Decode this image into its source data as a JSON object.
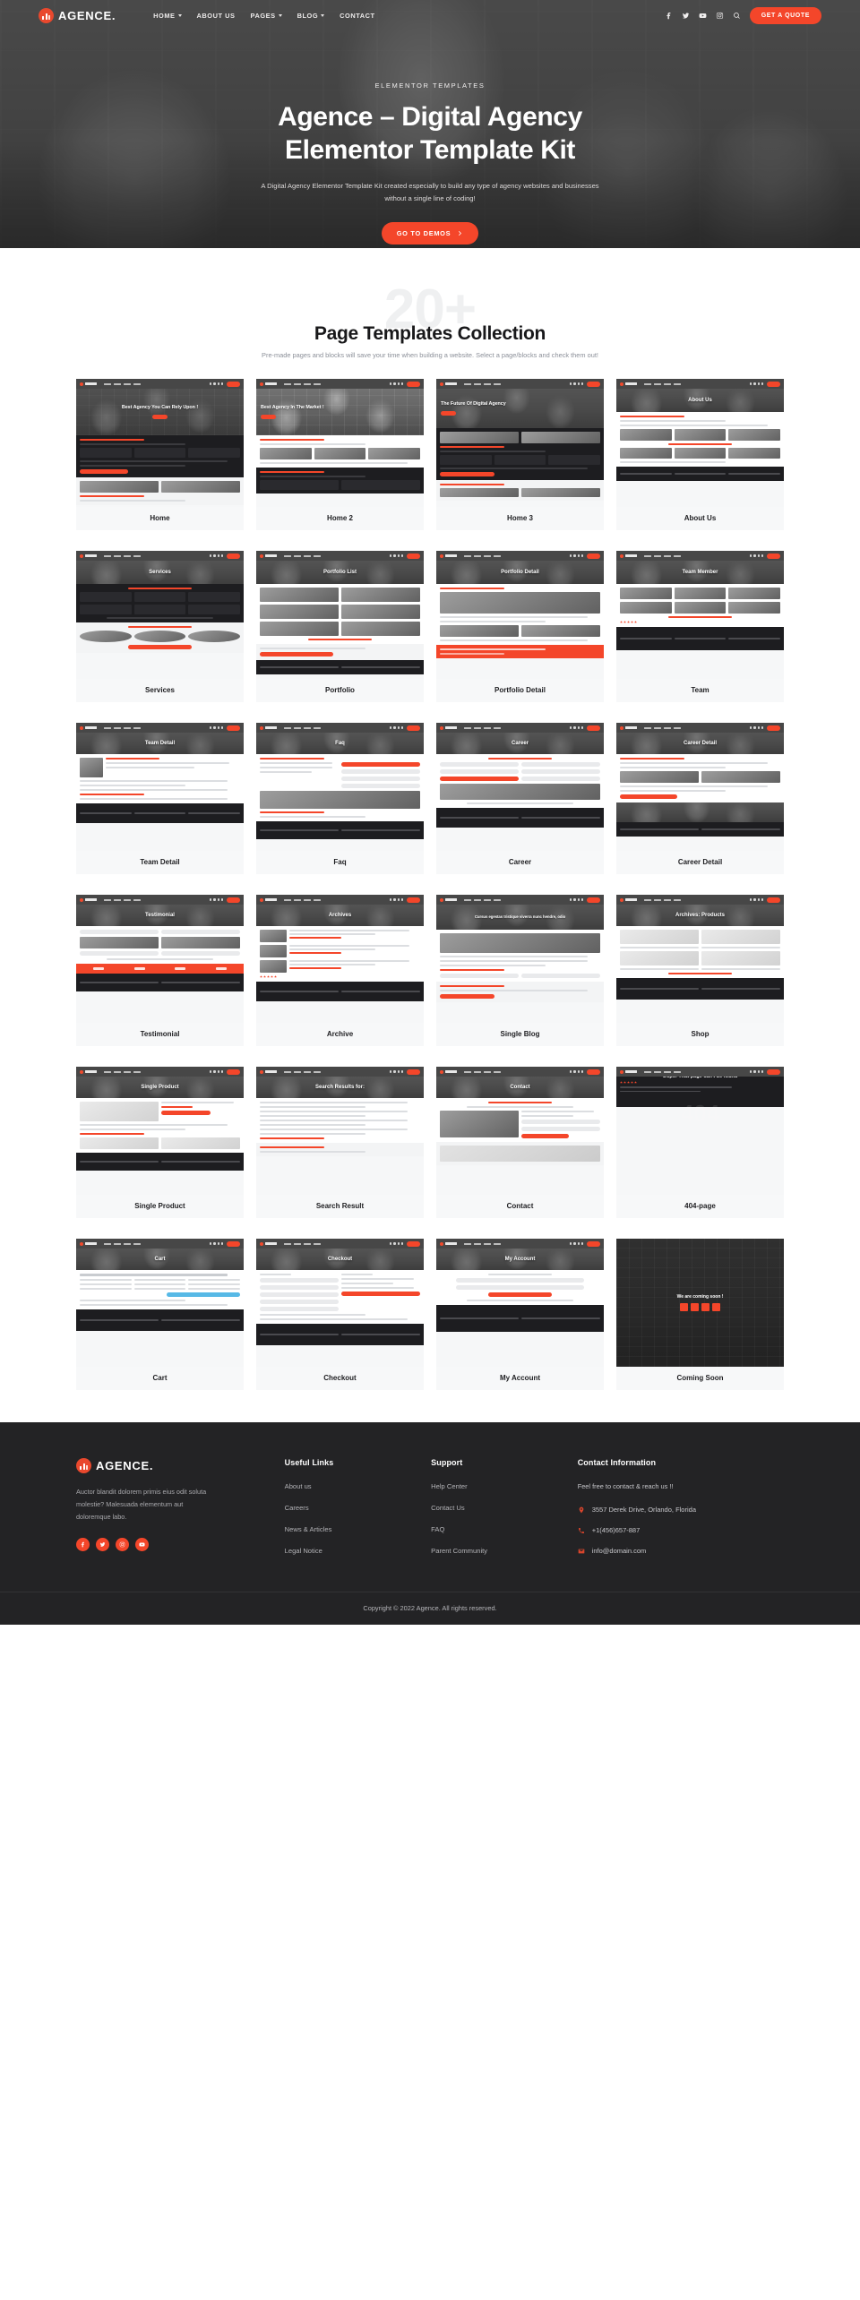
{
  "colors": {
    "accent": "#f4462a",
    "dark": "#232325",
    "light": "#f7f8f9"
  },
  "header": {
    "brand": "AGENCE.",
    "menu": [
      {
        "label": "HOME",
        "has_dropdown": true
      },
      {
        "label": "ABOUT US",
        "has_dropdown": false
      },
      {
        "label": "PAGES",
        "has_dropdown": true
      },
      {
        "label": "BLOG",
        "has_dropdown": true
      },
      {
        "label": "CONTACT",
        "has_dropdown": false
      }
    ],
    "socials": [
      "facebook-icon",
      "twitter-icon",
      "youtube-icon",
      "instagram-icon",
      "search-icon"
    ],
    "quote_label": "GET A QUOTE"
  },
  "hero": {
    "eyebrow": "ELEMENTOR TEMPLATES",
    "title_line1": "Agence – Digital Agency",
    "title_line2": "Elementor Template Kit",
    "subtitle": "A Digital Agency Elementor Template Kit created especially to build any type of  agency websites and businesses without a single line of coding!",
    "cta_label": "GO TO DEMOS"
  },
  "collection": {
    "ghost_number": "20+",
    "title": "Page Templates Collection",
    "subtitle": "Pre-made pages and blocks will save your time when building a website. Select a page/blocks and check them out!",
    "cards": [
      {
        "label": "Home",
        "headline": "Best Agency You Can Rely Upon !",
        "style": "dark"
      },
      {
        "label": "Home 2",
        "headline": "Best Agency In The Market !",
        "style": "dark"
      },
      {
        "label": "Home 3",
        "headline": "The Future Of Digital Agency",
        "style": "dark"
      },
      {
        "label": "About Us",
        "headline": "About Us",
        "style": "light"
      },
      {
        "label": "Services",
        "headline": "Services",
        "style": "dark"
      },
      {
        "label": "Portfolio",
        "headline": "Portfolio List",
        "style": "light"
      },
      {
        "label": "Portfolio Detail",
        "headline": "Portfolio Detail",
        "style": "light"
      },
      {
        "label": "Team",
        "headline": "Team Member",
        "style": "light"
      },
      {
        "label": "Team Detail",
        "headline": "Team Detail",
        "style": "light"
      },
      {
        "label": "Faq",
        "headline": "Faq",
        "style": "light"
      },
      {
        "label": "Career",
        "headline": "Career",
        "style": "light"
      },
      {
        "label": "Career Detail",
        "headline": "Career Detail",
        "style": "light"
      },
      {
        "label": "Testimonial",
        "headline": "Testimonial",
        "style": "light"
      },
      {
        "label": "Archive",
        "headline": "Archives",
        "style": "light"
      },
      {
        "label": "Single Blog",
        "headline": "Cursus egestas tristique viverra nunc hendre, odio",
        "style": "light"
      },
      {
        "label": "Shop",
        "headline": "Archives: Products",
        "style": "light"
      },
      {
        "label": "Single Product",
        "headline": "Single Product",
        "style": "light"
      },
      {
        "label": "Search Result",
        "headline": "Search Results for:",
        "style": "light"
      },
      {
        "label": "Contact",
        "headline": "Contact",
        "style": "light"
      },
      {
        "label": "404-page",
        "headline": "404",
        "style": "dark",
        "error_text": "Oops! That page can't be found"
      },
      {
        "label": "Cart",
        "headline": "Cart",
        "style": "light"
      },
      {
        "label": "Checkout",
        "headline": "Checkout",
        "style": "light"
      },
      {
        "label": "My Account",
        "headline": "My Account",
        "style": "light"
      },
      {
        "label": "Coming Soon",
        "headline": "We are coming soon !",
        "style": "dark"
      }
    ]
  },
  "footer": {
    "brand": "AGENCE.",
    "about": "Auctor blandit dolorem primis eius odit soluta molestie? Malesuada elementum aut doloremque labo.",
    "socials": [
      "facebook-icon",
      "twitter-icon",
      "instagram-icon",
      "youtube-icon"
    ],
    "useful_links": {
      "heading": "Useful Links",
      "items": [
        "About us",
        "Careers",
        "News & Articles",
        "Legal Notice"
      ]
    },
    "support": {
      "heading": "Support",
      "items": [
        "Help Center",
        "Contact Us",
        "FAQ",
        "Parent Community"
      ]
    },
    "contact": {
      "heading": "Contact Information",
      "note": "Feel free to contact & reach us !!",
      "address": "3557 Derek Drive, Orlando, Florida",
      "phone": "+1(456)657-887",
      "email": "info@domain.com"
    },
    "copyright": "Copyright © 2022 Agence. All rights reserved."
  }
}
